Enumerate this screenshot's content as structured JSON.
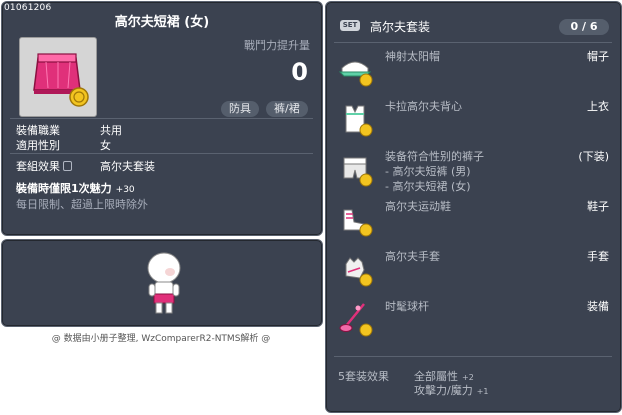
{
  "item": {
    "code": "01061206",
    "title": "高尔夫短裙 (女)",
    "cp_label": "戰鬥力提升量",
    "cp_value": "0",
    "tags": [
      "防具",
      "裤/裙"
    ],
    "job_label": "裝備職業",
    "job_value": "共用",
    "gender_label": "適用性別",
    "gender_value": "女",
    "set_label": "套組效果",
    "set_value": "高尔夫套装",
    "bonus_text": "裝備時僅限1次魅力",
    "bonus_value": "+30",
    "limit_text": "每日限制、超過上限時除外"
  },
  "credit": "@ 数据由小册子整理, WzComparerR2-NTMS解析 @",
  "set": {
    "badge": "SET",
    "name": "高尔夫套装",
    "count": "0 / 6",
    "items": [
      {
        "name": "神射太阳帽",
        "slot": "帽子"
      },
      {
        "name": "卡拉高尔夫背心",
        "slot": "上衣"
      },
      {
        "name": "装备符合性别的裤子",
        "slot": "(下装)",
        "subs": [
          "- 高尔夫短裤 (男)",
          "- 高尔夫短裙 (女)"
        ]
      },
      {
        "name": "高尔夫运动鞋",
        "slot": "鞋子"
      },
      {
        "name": "高尔夫手套",
        "slot": "手套"
      },
      {
        "name": "时髦球杆",
        "slot": "装備"
      }
    ],
    "effect_label": "5套装效果",
    "effects": [
      {
        "text": "全部屬性",
        "value": "+2"
      },
      {
        "text": "攻擊力/魔力",
        "value": "+1"
      }
    ]
  },
  "colors": {
    "panel": "#3b4250",
    "muted_text": "#a8aebb",
    "coin": "#f2c420",
    "skirt": "#e0307a"
  },
  "icons": [
    "skirt-icon",
    "coin-icon",
    "lock-icon",
    "character-avatar",
    "cap-icon",
    "vest-icon",
    "shorts-icon",
    "shoes-icon",
    "glove-icon",
    "golf-club-icon"
  ]
}
